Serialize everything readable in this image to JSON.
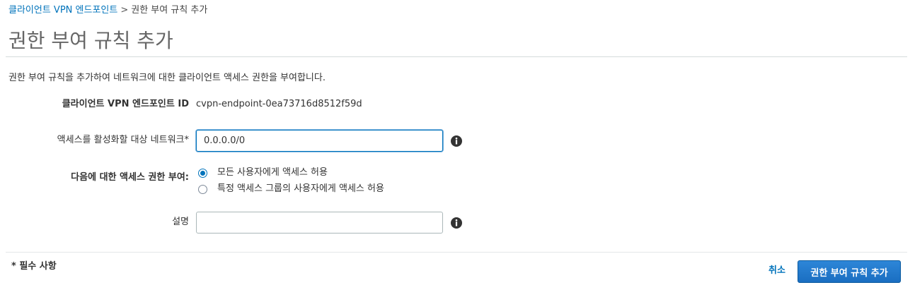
{
  "breadcrumb": {
    "parent_link": "클라이언트 VPN 엔드포인트",
    "separator": ">",
    "current": "권한 부여 규칙 추가"
  },
  "page": {
    "title": "권한 부여 규칙 추가",
    "description": "권한 부여 규칙을 추가하여 네트워크에 대한 클라이언트 액세스 권한을 부여합니다."
  },
  "form": {
    "endpoint_id": {
      "label": "클라이언트 VPN 엔드포인트 ID",
      "value": "cvpn-endpoint-0ea73716d8512f59d"
    },
    "destination_network": {
      "label": "액세스를 활성화할 대상 네트워크*",
      "value": "0.0.0.0/0",
      "placeholder": "",
      "info_icon": "info-circle-icon"
    },
    "grant_access_to": {
      "label": "다음에 대한 액세스 권한 부여:",
      "options": [
        {
          "label": "모든 사용자에게 액세스 허용",
          "selected": true
        },
        {
          "label": "특정 액세스 그룹의 사용자에게 액세스 허용",
          "selected": false
        }
      ]
    },
    "description_field": {
      "label": "설명",
      "value": "",
      "placeholder": "",
      "info_icon": "info-circle-icon"
    }
  },
  "footer": {
    "required_note": "* 필수 사항",
    "cancel_label": "취소",
    "submit_label": "권한 부여 규칙 추가"
  },
  "colors": {
    "link": "#0073bb",
    "primary_button": "#1a6ec1",
    "title": "#666666",
    "text": "#333333"
  }
}
